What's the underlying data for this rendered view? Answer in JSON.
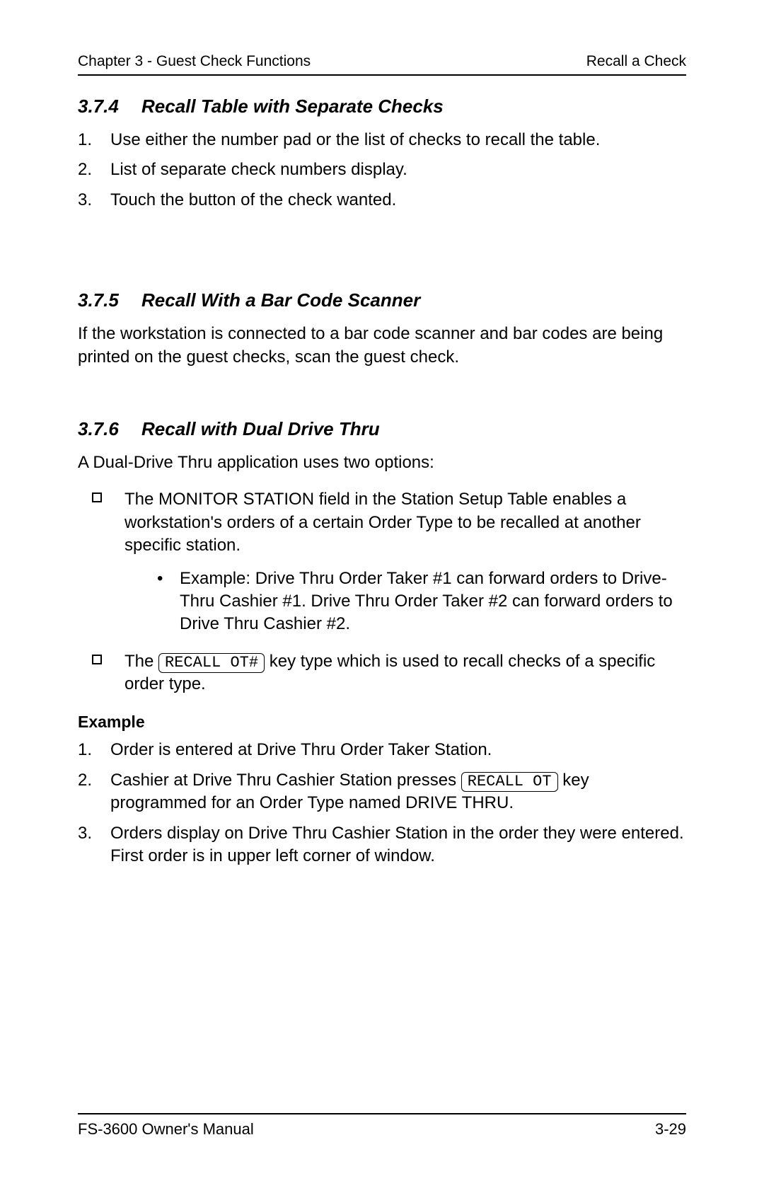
{
  "header": {
    "left": "Chapter 3 - Guest Check Functions",
    "right": "Recall a Check"
  },
  "sections": {
    "s374": {
      "number": "3.7.4",
      "title": "Recall Table with Separate Checks",
      "steps": [
        "Use either the number pad or the list of checks to recall the table.",
        "List of separate check numbers display.",
        "Touch the button of the check wanted."
      ]
    },
    "s375": {
      "number": "3.7.5",
      "title": "Recall With a Bar Code Scanner",
      "para": "If the workstation is connected to a bar code scanner and bar codes are being printed on the guest checks, scan the guest check."
    },
    "s376": {
      "number": "3.7.6",
      "title": "Recall with Dual Drive Thru",
      "intro": "A Dual-Drive Thru application uses two options:",
      "bullets": {
        "b1": "The MONITOR STATION field in the Station Setup Table enables a workstation's orders of a certain Order Type to be recalled at another specific station.",
        "b1_example": "Example:  Drive Thru Order Taker #1 can forward orders to Drive-Thru Cashier #1.  Drive Thru Order Taker #2 can forward orders to Drive Thru Cashier #2.",
        "b2_pre": "The  ",
        "b2_key": "RECALL OT#",
        "b2_post": "  key type which is used to recall checks of a specific order type."
      },
      "example_label": "Example",
      "example_steps": {
        "e1": "Order is entered at Drive Thru Order Taker Station.",
        "e2_pre": "Cashier at Drive Thru Cashier Station presses  ",
        "e2_key": "RECALL OT",
        "e2_post": " key programmed for an Order Type named DRIVE THRU.",
        "e3": "Orders display on Drive Thru Cashier Station in the order they were entered.  First order is in upper left corner of window."
      }
    }
  },
  "footer": {
    "left": "FS-3600 Owner's Manual",
    "right": "3-29"
  }
}
